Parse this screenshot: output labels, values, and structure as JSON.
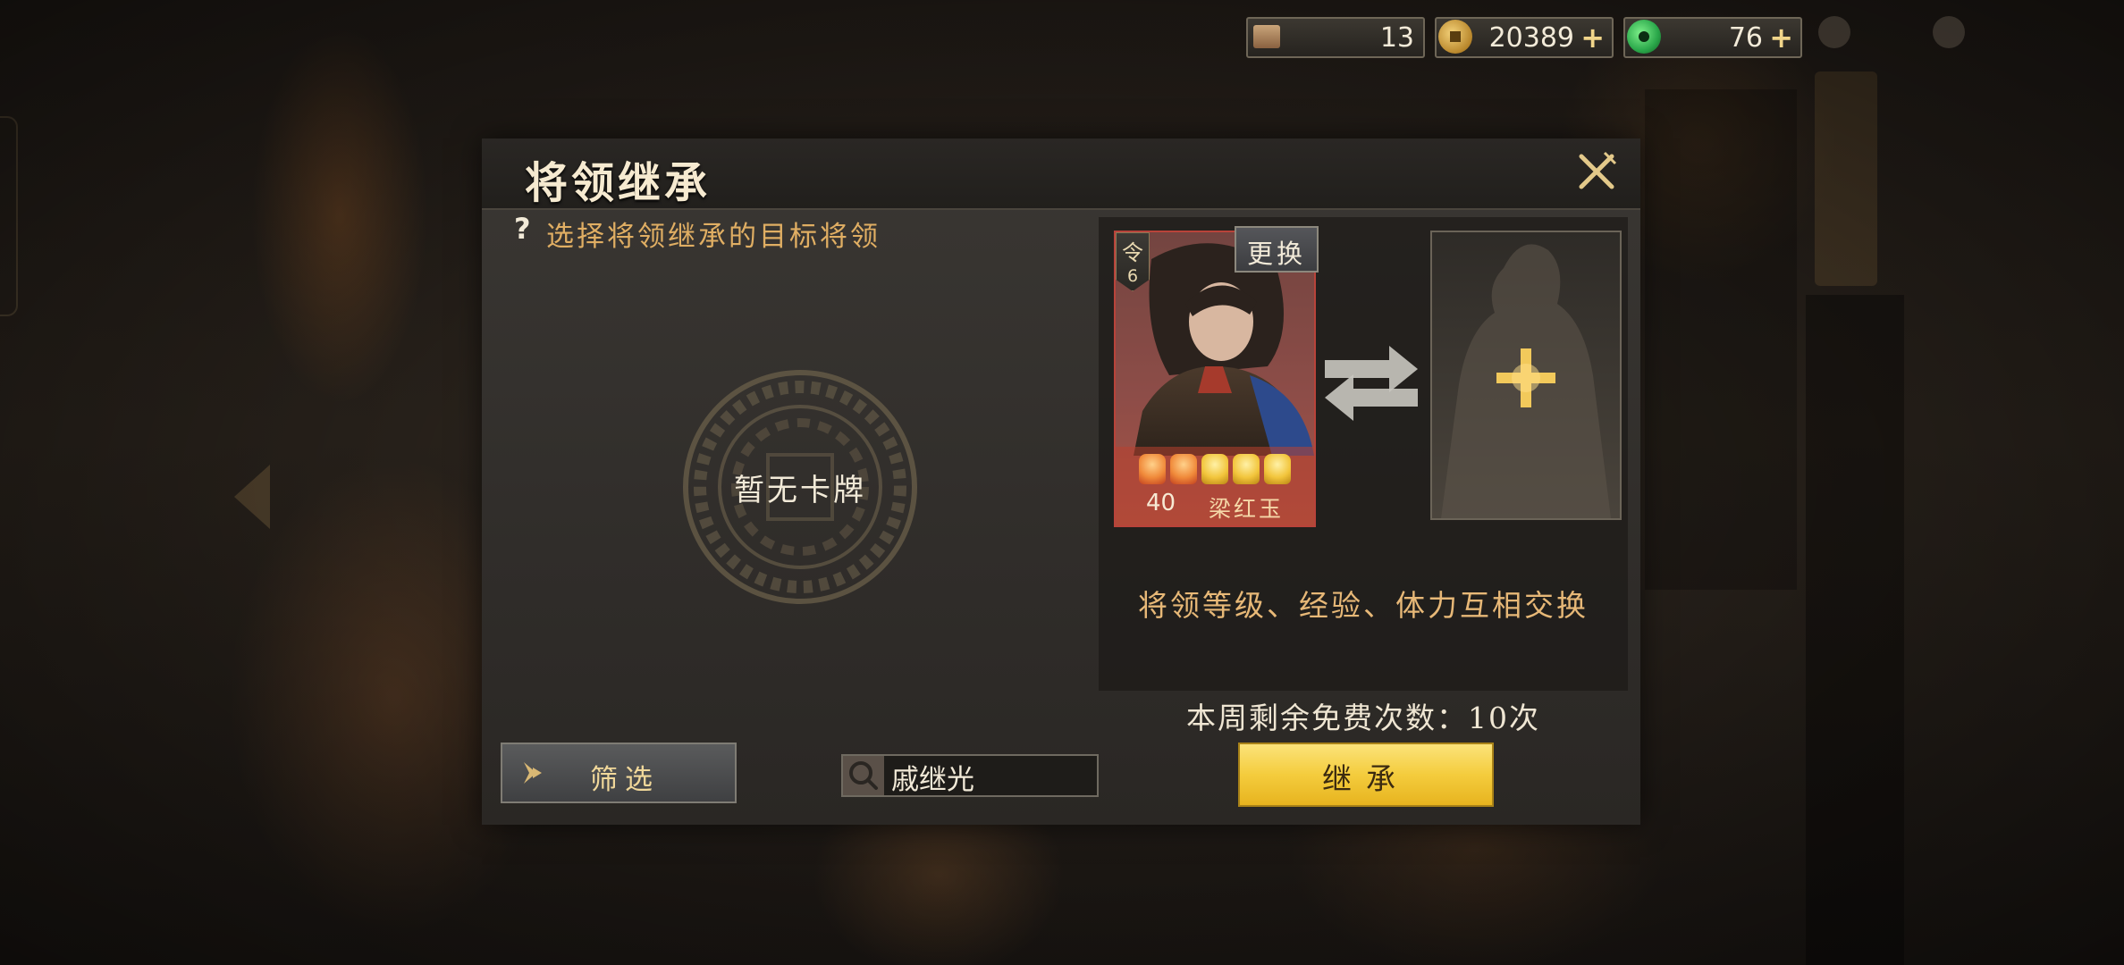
{
  "currencies": [
    {
      "icon": "scroll-icon",
      "value": "13",
      "has_plus": false
    },
    {
      "icon": "gold-coin-icon",
      "value": "20389",
      "has_plus": true
    },
    {
      "icon": "jade-icon",
      "value": "76",
      "has_plus": true
    }
  ],
  "plus_symbol": "+",
  "dialog": {
    "title": "将领继承",
    "close_icon": "close-icon",
    "help_icon_text": "?",
    "hint": "选择将领继承的目标将领",
    "empty_label": "暂无卡牌",
    "filter_label": "筛选",
    "search_value": "戚继光",
    "card": {
      "order_char": "令",
      "order_number": "6",
      "level": "40",
      "name": "梁红玉",
      "stars_red": 2,
      "stars_gold": 3,
      "replace_label": "更换"
    },
    "exchange_text": "将领等级、经验、体力互相交换",
    "free_count": "本周剩余免费次数：10次",
    "inherit_label": "继承"
  },
  "colors": {
    "accent_gold": "#f4cc3d",
    "hint_orange": "#e0ae63",
    "card_red": "#b8433a"
  }
}
